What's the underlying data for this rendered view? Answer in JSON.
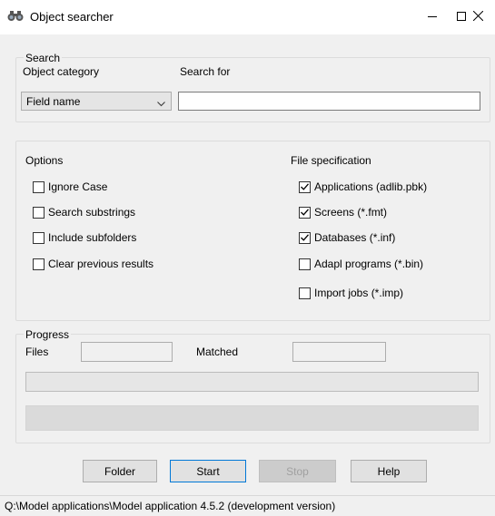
{
  "window": {
    "title": "Object searcher",
    "icon": "binoculars-icon",
    "controls": [
      "minimize-icon",
      "maximize-icon",
      "close-icon"
    ]
  },
  "search": {
    "legend": "Search",
    "category_label": "Object category",
    "search_for_label": "Search for",
    "category_value": "Field name",
    "search_value": ""
  },
  "options": {
    "label": "Options",
    "items": [
      {
        "label": "Ignore Case",
        "checked": false
      },
      {
        "label": "Search substrings",
        "checked": false
      },
      {
        "label": "Include subfolders",
        "checked": false
      },
      {
        "label": "Clear previous results",
        "checked": false
      }
    ]
  },
  "file_spec": {
    "label": "File specification",
    "items": [
      {
        "label": "Applications (adlib.pbk)",
        "checked": true
      },
      {
        "label": "Screens (*.fmt)",
        "checked": true
      },
      {
        "label": "Databases (*.inf)",
        "checked": true
      },
      {
        "label": "Adapl programs (*.bin)",
        "checked": false
      },
      {
        "label": "Import jobs (*.imp)",
        "checked": false
      }
    ]
  },
  "progress": {
    "legend": "Progress",
    "files_label": "Files",
    "files_value": "",
    "matched_label": "Matched",
    "matched_value": ""
  },
  "buttons": {
    "folder": "Folder",
    "start": "Start",
    "stop": "Stop",
    "help": "Help"
  },
  "status": {
    "text": "Q:\\Model applications\\Model application 4.5.2 (development version)"
  },
  "colors": {
    "window_bg": "#f0f0f0",
    "focus_border": "#0078d7",
    "disabled_text": "#a0a0a0"
  }
}
